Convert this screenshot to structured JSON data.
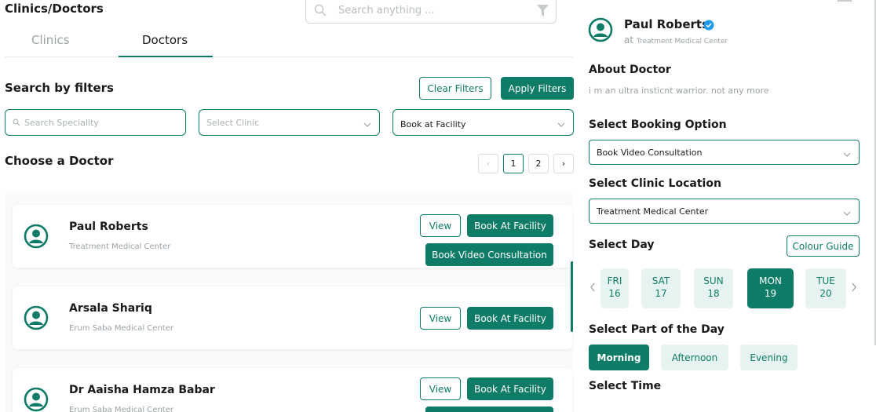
{
  "header": {
    "title": "Clinics/Doctors",
    "search_placeholder": "Search anything ..."
  },
  "tabs": [
    {
      "label": "Clinics",
      "active": false
    },
    {
      "label": "Doctors",
      "active": true
    }
  ],
  "filters": {
    "title": "Search by filters",
    "clear_label": "Clear Filters",
    "apply_label": "Apply Filters",
    "speciality_placeholder": "Search Speciality",
    "clinic_placeholder": "Select Clinic",
    "booking_type_value": "Book at Facility"
  },
  "doctors_list": {
    "title": "Choose a Doctor",
    "pages": [
      "1",
      "2"
    ],
    "current_page": "1",
    "items": [
      {
        "name": "Paul Roberts",
        "clinic": "Treatment Medical Center",
        "view_label": "View",
        "book_facility_label": "Book At Facility",
        "book_video_label": "Book Video Consultation"
      },
      {
        "name": "Arsala Shariq",
        "clinic": "Erum Saba Medical Center",
        "view_label": "View",
        "book_facility_label": "Book At Facility"
      },
      {
        "name": "Dr Aaisha Hamza Babar",
        "clinic": "Erum Saba Medical Center",
        "view_label": "View",
        "book_facility_label": "Book At Facility"
      }
    ]
  },
  "detail": {
    "name": "Paul Roberts",
    "at_prefix": "at",
    "clinic": "Treatment Medical Center",
    "about_title": "About Doctor",
    "about_text": "i m an ultra insticnt warrior. not any more",
    "booking_option_title": "Select Booking Option",
    "booking_option_value": "Book Video Consultation",
    "location_title": "Select Clinic Location",
    "location_value": "Treatment Medical Center",
    "day_title": "Select Day",
    "colour_guide_label": "Colour Guide",
    "days": [
      {
        "dow": "FRI",
        "date": "16"
      },
      {
        "dow": "SAT",
        "date": "17"
      },
      {
        "dow": "SUN",
        "date": "18"
      },
      {
        "dow": "MON",
        "date": "19",
        "selected": true
      },
      {
        "dow": "TUE",
        "date": "20"
      }
    ],
    "part_title": "Select Part of the Day",
    "parts": [
      "Morning",
      "Afternoon",
      "Evening"
    ],
    "selected_part": "Morning",
    "time_title": "Select Time"
  },
  "colors": {
    "accent": "#0e7c66",
    "accent_light": "#e6f3f0"
  }
}
